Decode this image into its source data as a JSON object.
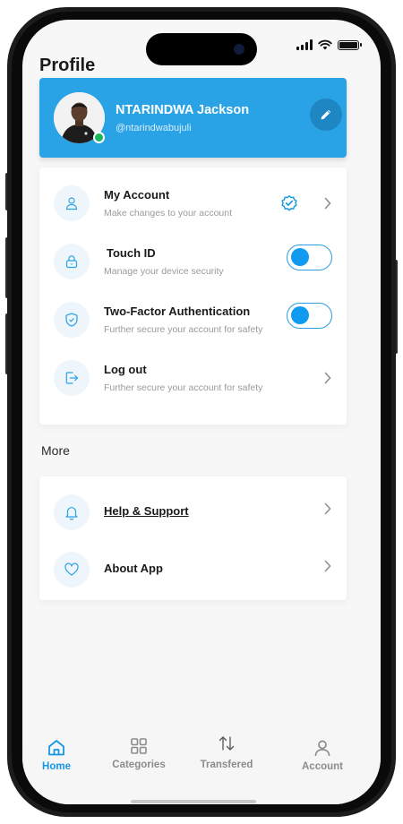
{
  "header": {
    "title": "Profile"
  },
  "profile": {
    "name": "NTARINDWA Jackson",
    "handle": "@ntarindwabujuli",
    "online": true
  },
  "account_settings": [
    {
      "label": "My Account",
      "subtitle": "Make changes to your account",
      "icon": "user-icon",
      "control": "chevron",
      "verified": true
    },
    {
      "label": "Touch ID",
      "subtitle": "Manage your device security",
      "icon": "lock-icon",
      "control": "toggle"
    },
    {
      "label": "Two-Factor Authentication",
      "subtitle": "Further secure your account for safety",
      "icon": "shield-icon",
      "control": "toggle"
    },
    {
      "label": "Log out",
      "subtitle": "Further secure your account for safety",
      "icon": "logout-icon",
      "control": "chevron"
    }
  ],
  "more": {
    "title": "More",
    "items": [
      {
        "label": "Help & Support",
        "icon": "bell-icon"
      },
      {
        "label": "About App",
        "icon": "heart-icon"
      }
    ]
  },
  "tabbar": {
    "items": [
      {
        "label": "Home",
        "icon": "home-icon",
        "active": true
      },
      {
        "label": "Categories",
        "icon": "grid-icon",
        "active": false
      },
      {
        "label": "Transfered",
        "icon": "transfer-arrows-icon",
        "active": false
      },
      {
        "label": "Account",
        "icon": "person-icon",
        "active": false
      }
    ]
  },
  "colors": {
    "accent": "#2aa3e6",
    "accent_dark": "#1e86c3",
    "toggle_on": "#119bf0",
    "online": "#1bb55c",
    "icon_bg": "#eef6fc"
  }
}
